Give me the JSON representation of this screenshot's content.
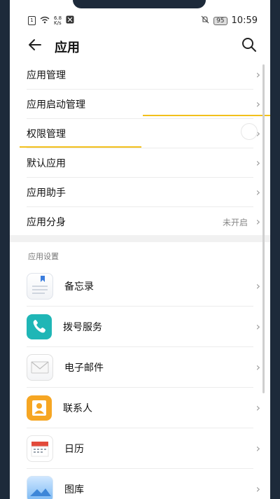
{
  "status_bar": {
    "sim_label": "1",
    "speed_value": "6.8",
    "speed_unit": "K/s",
    "battery": "95",
    "time": "10:59"
  },
  "header": {
    "title": "应用",
    "back_icon": "back-arrow-icon",
    "search_icon": "search-icon"
  },
  "list": [
    {
      "label": "应用管理"
    },
    {
      "label": "应用启动管理"
    },
    {
      "label": "权限管理"
    },
    {
      "label": "默认应用"
    },
    {
      "label": "应用助手"
    },
    {
      "label": "应用分身",
      "value": "未开启"
    }
  ],
  "section": {
    "title": "应用设置"
  },
  "apps": [
    {
      "label": "备忘录",
      "icon": "memo-icon"
    },
    {
      "label": "拨号服务",
      "icon": "phone-icon"
    },
    {
      "label": "电子邮件",
      "icon": "mail-icon"
    },
    {
      "label": "联系人",
      "icon": "contacts-icon"
    },
    {
      "label": "日历",
      "icon": "calendar-icon"
    },
    {
      "label": "图库",
      "icon": "gallery-icon"
    }
  ],
  "colors": {
    "annotation_yellow": "#f2c01c",
    "phone_teal": "#1fb6b6",
    "contacts_orange": "#f6a623",
    "calendar_red": "#e24a3b"
  }
}
